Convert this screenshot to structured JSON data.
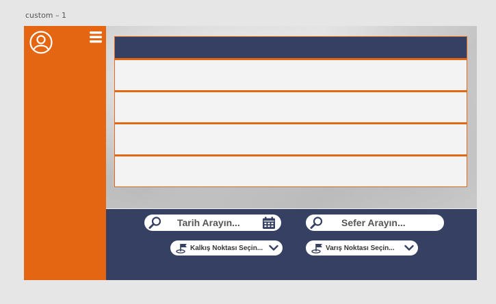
{
  "frame": {
    "title": "custom – 1"
  },
  "colors": {
    "sidebar": "#e46613",
    "navy": "#364063",
    "row": "#f3f3f3"
  },
  "sidebar": {
    "avatar_icon": "user-circle-icon",
    "menu_icon": "hamburger-icon"
  },
  "table": {
    "header": "",
    "rows": [
      "",
      "",
      "",
      ""
    ]
  },
  "search": {
    "date": {
      "placeholder": "Tarih Arayın...",
      "icon": "search-icon",
      "trailing_icon": "calendar-icon"
    },
    "trip": {
      "placeholder": "Sefer Arayın...",
      "icon": "search-icon"
    },
    "departure": {
      "label": "Kalkış Noktası Seçin...",
      "icon": "flag-icon",
      "trailing_icon": "chevron-down-icon"
    },
    "arrival": {
      "label": "Varış Noktası Seçin...",
      "icon": "flag-icon",
      "trailing_icon": "chevron-down-icon"
    }
  }
}
